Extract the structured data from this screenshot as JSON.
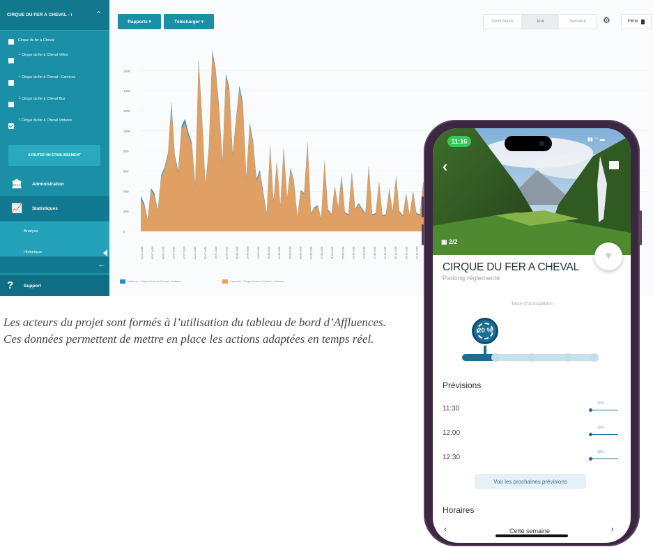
{
  "dashboard": {
    "sidebar": {
      "header": "CIRQUE DU FER À CHEVAL - \\",
      "items": [
        {
          "label": "Cirque du fer à Cheval",
          "checked": false
        },
        {
          "label": "└ Cirque du fer à Cheval Vélos",
          "checked": false
        },
        {
          "label": "└ Cirque du fer à Cheval - Camions",
          "checked": false
        },
        {
          "label": "└ Cirque du fer à Cheval Bus",
          "checked": false
        },
        {
          "label": "└ Cirque du fer à Cheval Voitures",
          "checked": true
        }
      ],
      "add_button": "AJOUTER UN ÉTABLISSEMENT",
      "nav": {
        "administration": "Administration",
        "statistiques": "Statistiques",
        "analyse": "Analyse",
        "historique": "Historique",
        "support": "Support"
      }
    },
    "toolbar": {
      "rapports": "Rapports ▾",
      "telecharger": "Télécharger ▾",
      "periods": [
        "Demi-heure",
        "Jour",
        "Semaine"
      ],
      "active_period": "Jour",
      "filter": "Filtrer"
    },
    "legend": {
      "series1": "Visiteurs - Cirque du fer à Cheval - Voitures",
      "series2": "Capacité - Cirque du fer à Cheval - Voitures"
    },
    "colors": {
      "blue": "#1f8fc6",
      "orange": "#f0a05a",
      "teal": "#1a8fa6"
    }
  },
  "chart_data": {
    "type": "area",
    "ylim": [
      0,
      1900
    ],
    "yticks": [
      0,
      200,
      400,
      600,
      800,
      1000,
      1200,
      1400,
      1600
    ],
    "xticks": [
      "01-07-2020",
      "05-07-2020",
      "09-07-2020",
      "13-07-2020",
      "17-07-2020",
      "21-07-2020",
      "25-07-2020",
      "29-07-2020",
      "02-08-2020",
      "06-08-2020",
      "10-08-2020",
      "14-08-2020",
      "18-08-2020",
      "22-08-2020",
      "26-08-2020",
      "30-08-2020",
      "03-09-2020",
      "07-09-2020",
      "11-09-2020",
      "15-09-2020",
      "19-09-2020",
      "23-09-2020",
      "27-09-2020",
      "01-10-2020",
      "05-10-2020",
      "09-10-2020",
      "13-10-2020",
      "17-10-2020",
      "21-10-2020"
    ],
    "series": [
      {
        "values": [
          350,
          280,
          120,
          430,
          380,
          210,
          560,
          640,
          780,
          1290,
          760,
          600,
          1050,
          1120,
          980,
          880,
          470,
          1720,
          1150,
          470,
          840,
          1800,
          1620,
          1250,
          700,
          1570,
          1430,
          770,
          1120,
          1450,
          1280,
          540,
          1080,
          900,
          520,
          610,
          390,
          180,
          860,
          300,
          700,
          260,
          840,
          330,
          630,
          500,
          150,
          410,
          380,
          900,
          180,
          240,
          260,
          130,
          710,
          220,
          170,
          450,
          240,
          560,
          190,
          170,
          590,
          220,
          280,
          230,
          180,
          660,
          170,
          180,
          500,
          160,
          170,
          420,
          200,
          550,
          200,
          160,
          380,
          160,
          400,
          180,
          170,
          500,
          190,
          130,
          350
        ]
      },
      {
        "values": [
          330,
          260,
          110,
          410,
          360,
          200,
          540,
          620,
          760,
          1260,
          740,
          580,
          1020,
          1080,
          950,
          860,
          450,
          1700,
          1130,
          450,
          820,
          1770,
          1600,
          1220,
          680,
          1540,
          1400,
          750,
          1100,
          1420,
          1250,
          520,
          1060,
          880,
          500,
          590,
          370,
          170,
          840,
          290,
          680,
          250,
          820,
          320,
          610,
          490,
          140,
          400,
          370,
          880,
          170,
          230,
          250,
          120,
          690,
          210,
          160,
          440,
          230,
          540,
          180,
          160,
          570,
          210,
          270,
          220,
          170,
          640,
          160,
          170,
          480,
          150,
          160,
          410,
          190,
          530,
          190,
          150,
          370,
          150,
          390,
          170,
          160,
          490,
          180,
          120,
          340
        ]
      }
    ]
  },
  "caption": "Les acteurs du projet sont formés à l’utilisation du tableau de bord d’Affluences. Ces données permettent de mettre en place les actions adaptées en temps réel.",
  "phone": {
    "time": "11:16",
    "photo_count": "2/2",
    "title": "CIRQUE DU FER A CHEVAL",
    "subtitle": "Parking réglementé",
    "occupancy_label": "Taux d'occupation",
    "occupancy_pct": "20 %",
    "occupancy_value": 0.2,
    "forecasts_title": "Prévisions",
    "forecasts": [
      {
        "time": "11:30",
        "pct": "10%"
      },
      {
        "time": "12:00",
        "pct": "10%"
      },
      {
        "time": "12:30",
        "pct": "10%"
      }
    ],
    "next_forecasts_button": "Voir les prochaines prévisions",
    "hours_title": "Horaires",
    "week_label": "Cette semaine"
  }
}
